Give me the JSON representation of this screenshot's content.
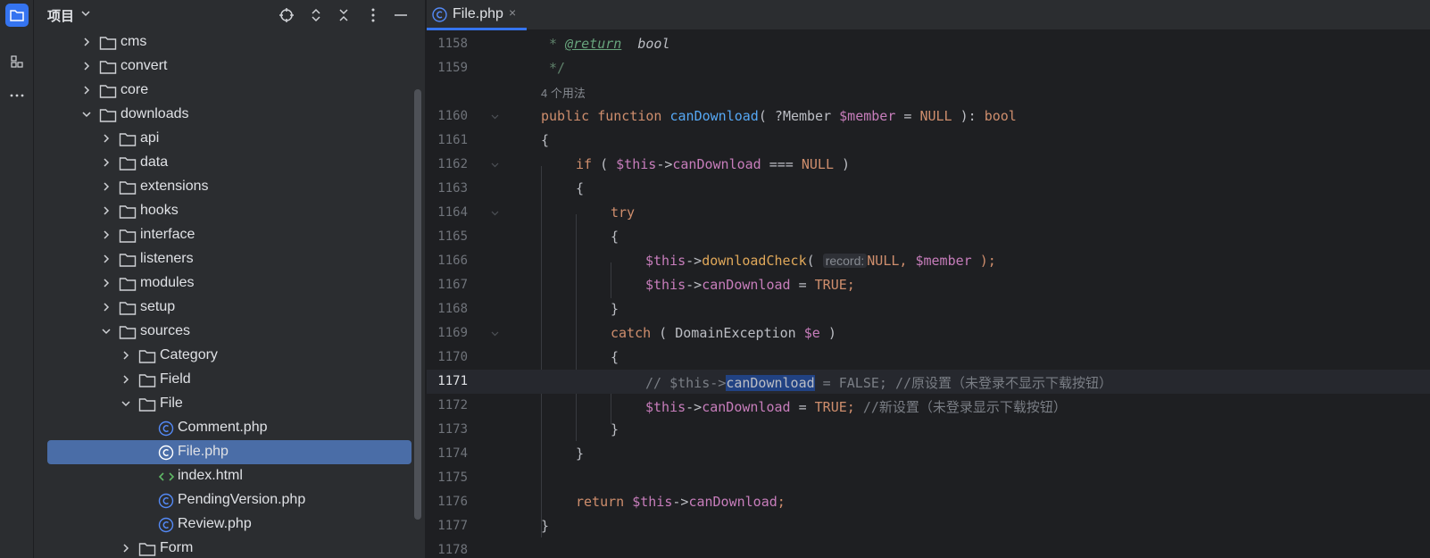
{
  "project_panel": {
    "title": "项目",
    "tree": [
      {
        "label": "cms",
        "type": "folder",
        "expanded": false,
        "depth": 0
      },
      {
        "label": "convert",
        "type": "folder",
        "expanded": false,
        "depth": 0
      },
      {
        "label": "core",
        "type": "folder",
        "expanded": false,
        "depth": 0
      },
      {
        "label": "downloads",
        "type": "folder",
        "expanded": true,
        "depth": 0
      },
      {
        "label": "api",
        "type": "folder",
        "expanded": false,
        "depth": 1
      },
      {
        "label": "data",
        "type": "folder",
        "expanded": false,
        "depth": 1
      },
      {
        "label": "extensions",
        "type": "folder",
        "expanded": false,
        "depth": 1
      },
      {
        "label": "hooks",
        "type": "folder",
        "expanded": false,
        "depth": 1
      },
      {
        "label": "interface",
        "type": "folder",
        "expanded": false,
        "depth": 1
      },
      {
        "label": "listeners",
        "type": "folder",
        "expanded": false,
        "depth": 1
      },
      {
        "label": "modules",
        "type": "folder",
        "expanded": false,
        "depth": 1
      },
      {
        "label": "setup",
        "type": "folder",
        "expanded": false,
        "depth": 1
      },
      {
        "label": "sources",
        "type": "folder",
        "expanded": true,
        "depth": 1
      },
      {
        "label": "Category",
        "type": "folder",
        "expanded": false,
        "depth": 2
      },
      {
        "label": "Field",
        "type": "folder",
        "expanded": false,
        "depth": 2
      },
      {
        "label": "File",
        "type": "folder",
        "expanded": true,
        "depth": 2
      },
      {
        "label": "Comment.php",
        "type": "php",
        "depth": 3
      },
      {
        "label": "File.php",
        "type": "php",
        "depth": 3,
        "selected": true
      },
      {
        "label": "index.html",
        "type": "html",
        "depth": 3
      },
      {
        "label": "PendingVersion.php",
        "type": "php",
        "depth": 3
      },
      {
        "label": "Review.php",
        "type": "php",
        "depth": 3
      },
      {
        "label": "Form",
        "type": "folder",
        "expanded": false,
        "depth": 2
      }
    ]
  },
  "editor": {
    "tab": {
      "label": "File.php",
      "close": "×"
    },
    "usage_hint": "4 个用法",
    "inlay_hint": "record:",
    "lines": [
      {
        "n": "1158"
      },
      {
        "n": "1159"
      },
      {
        "n": "1160"
      },
      {
        "n": "1161"
      },
      {
        "n": "1162"
      },
      {
        "n": "1163"
      },
      {
        "n": "1164"
      },
      {
        "n": "1165"
      },
      {
        "n": "1166"
      },
      {
        "n": "1167"
      },
      {
        "n": "1168"
      },
      {
        "n": "1169"
      },
      {
        "n": "1170"
      },
      {
        "n": "1171"
      },
      {
        "n": "1172"
      },
      {
        "n": "1173"
      },
      {
        "n": "1174"
      },
      {
        "n": "1175"
      },
      {
        "n": "1176"
      },
      {
        "n": "1177"
      },
      {
        "n": "1178"
      }
    ],
    "code": {
      "l1158_star": " * ",
      "l1158_tag": "@return",
      "l1158_type": "bool",
      "l1159": " */",
      "l1160_public": "public",
      "l1160_function": "function",
      "l1160_name": "canDownload",
      "l1160_open": "( ?",
      "l1160_type": "Member",
      "l1160_var": "$member",
      "l1160_eq": " = ",
      "l1160_null": "NULL",
      "l1160_close": " ): ",
      "l1160_ret": "bool",
      "brace_open": "{",
      "brace_close": "}",
      "l1162_if": "if",
      "l1162_open": " ( ",
      "this": "$this",
      "arrow": "->",
      "prop": "canDownload",
      "l1162_op": " === ",
      "null": "NULL",
      "l1162_close": " )",
      "try": "try",
      "l1166_method": "downloadCheck",
      "l1166_open": "( ",
      "l1166_null": "NULL, ",
      "l1166_var": "$member",
      "l1166_close": " );",
      "assign": " = ",
      "true": "TRUE;",
      "catch": "catch",
      "l1169_open": " ( ",
      "l1169_type": "DomainException",
      "l1169_var": " $e",
      "l1169_close": " )",
      "l1171_pre": "// $this->",
      "l1171_sel": "canDownload",
      "l1171_post": " = FALSE; //原设置（未登录不显示下载按钮）",
      "l1172_comment": " //新设置（未登录显示下载按钮）",
      "return": "return",
      "semi": ";"
    }
  },
  "colors": {
    "accent": "#3574f0",
    "selection": "#4a6da7",
    "keyword": "#cf8e6d",
    "variable": "#c77dbb",
    "function_decl": "#56a8f5",
    "comment": "#7a7e85"
  }
}
